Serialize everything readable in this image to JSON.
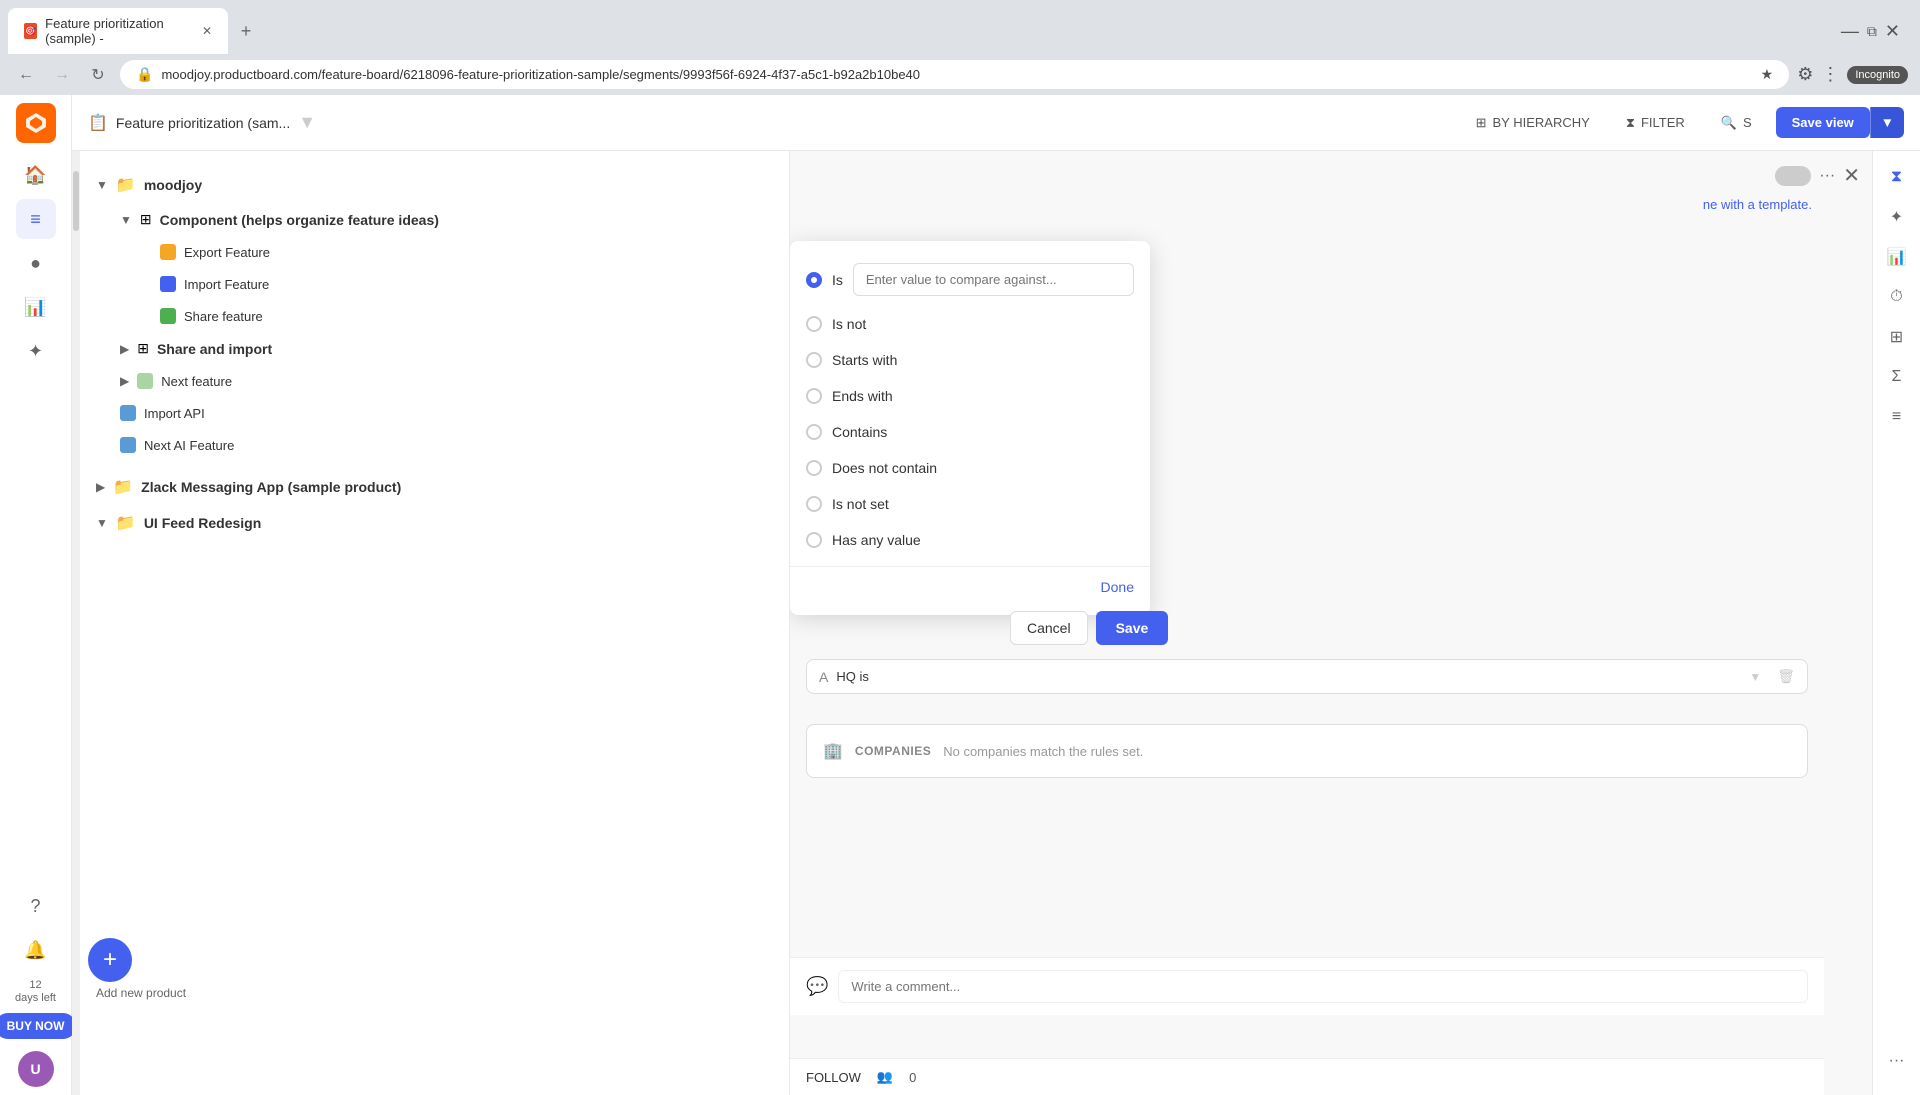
{
  "browser": {
    "tab_title": "Feature prioritization (sample) -",
    "tab_favicon": "🎯",
    "url": "moodjoy.productboard.com/feature-board/6218096-feature-prioritization-sample/segments/9993f56f-6924-4f37-a5c1-b92a2b10be40",
    "incognito_label": "Incognito",
    "new_tab_symbol": "+"
  },
  "toolbar": {
    "breadcrumb_label": "Feature prioritization (sam...",
    "hierarchy_label": "BY HIERARCHY",
    "filter_label": "FILTER",
    "search_placeholder": "S",
    "save_view_label": "Save view"
  },
  "sidebar": {
    "icons": [
      "home",
      "search",
      "list",
      "hierarchy",
      "star",
      "question",
      "bell"
    ]
  },
  "feature_tree": {
    "root_label": "moodjoy",
    "component_label": "Component (helps organize feature ideas)",
    "features": [
      {
        "name": "Export Feature",
        "color": "#f5a623"
      },
      {
        "name": "Import Feature",
        "color": "#4361ee"
      },
      {
        "name": "Share feature",
        "color": "#4caf50"
      }
    ],
    "share_import_label": "Share and import",
    "next_feature_label": "Next feature",
    "import_api_label": "Import API",
    "next_ai_label": "Next AI Feature",
    "zlack_label": "Zlack Messaging App (sample product)",
    "ui_feed_label": "UI Feed Redesign",
    "add_new_label": "Add new product",
    "days_left_number": "12",
    "days_left_label": "days left",
    "buy_now_label": "BUY NOW"
  },
  "filter_popup": {
    "input_placeholder": "Enter value to compare against...",
    "options": [
      {
        "label": "Is",
        "value": "is",
        "selected": true
      },
      {
        "label": "Is not",
        "value": "is_not",
        "selected": false
      },
      {
        "label": "Starts with",
        "value": "starts_with",
        "selected": false
      },
      {
        "label": "Ends with",
        "value": "ends_with",
        "selected": false
      },
      {
        "label": "Contains",
        "value": "contains",
        "selected": false
      },
      {
        "label": "Does not contain",
        "value": "does_not_contain",
        "selected": false
      },
      {
        "label": "Is not set",
        "value": "is_not_set",
        "selected": false
      },
      {
        "label": "Has any value",
        "value": "has_any_value",
        "selected": false
      }
    ],
    "done_label": "Done",
    "cancel_label": "Cancel",
    "save_label": "Save"
  },
  "segment_panel": {
    "template_text": "ne with a template.",
    "hq_filter_label": "HQ is",
    "companies_label": "COMPANIES",
    "companies_empty": "No companies match the rules set.",
    "comment_placeholder": "Write a comment...",
    "follow_label": "FOLLOW",
    "follow_count": "0"
  }
}
